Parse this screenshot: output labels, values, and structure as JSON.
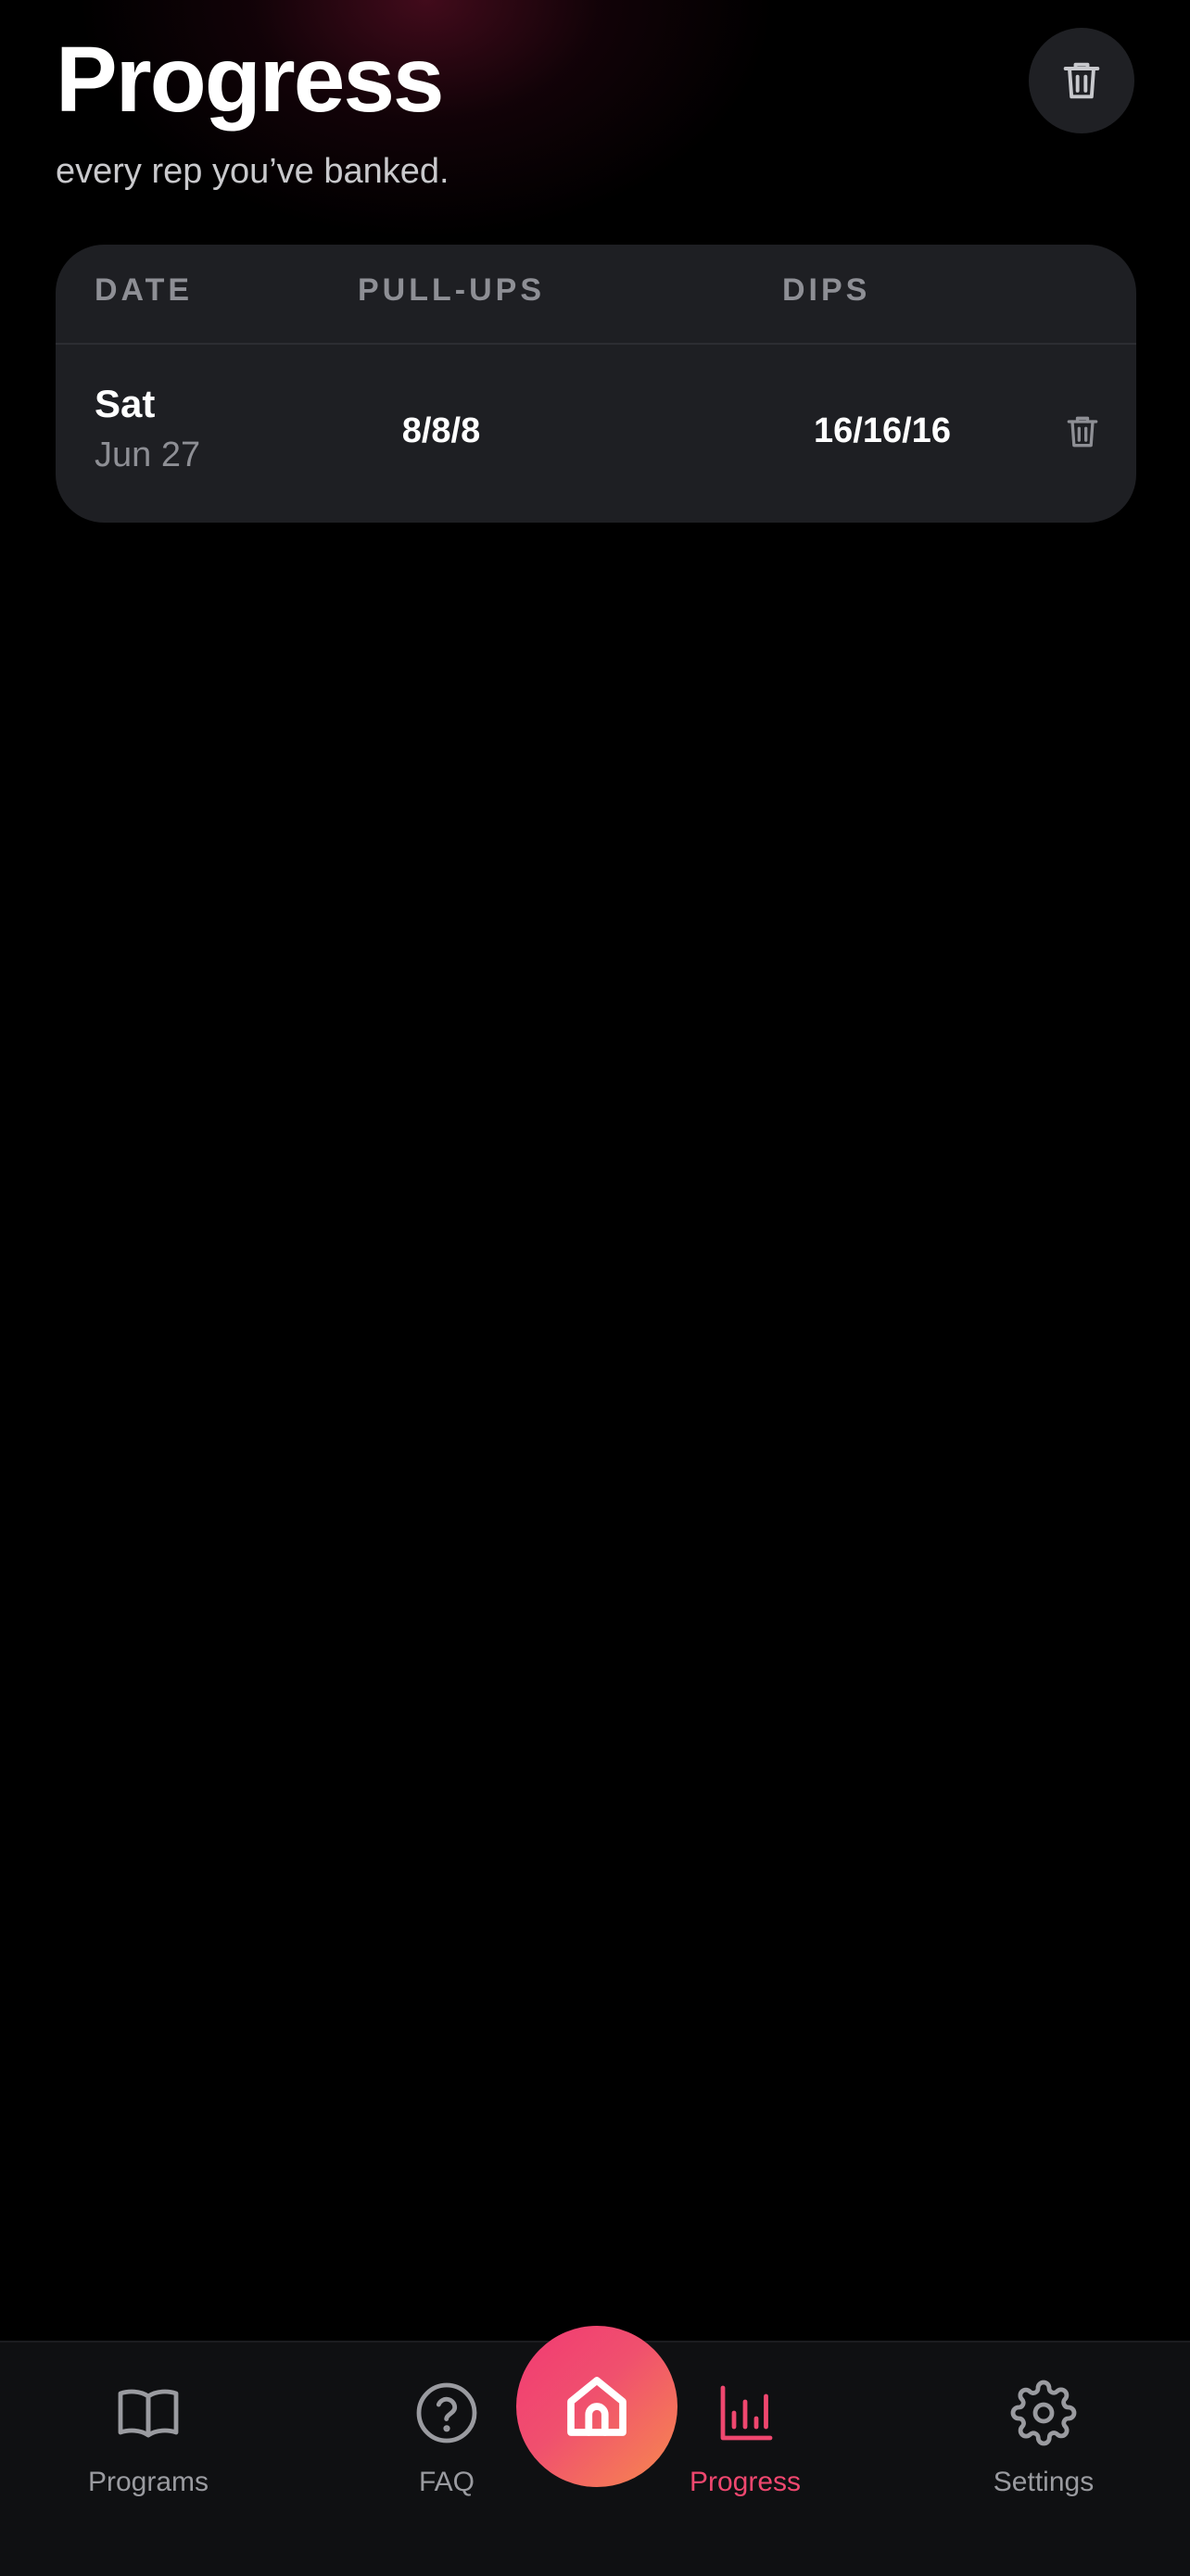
{
  "header": {
    "title": "Progress",
    "subtitle": "every rep you’ve banked."
  },
  "table": {
    "columns": [
      "DATE",
      "PULL-UPS",
      "DIPS"
    ],
    "rows": [
      {
        "day": "Sat",
        "date": "Jun 27",
        "pullups": "8/8/8",
        "dips": "16/16/16"
      }
    ]
  },
  "nav": {
    "items": [
      {
        "label": "Programs",
        "icon": "book-icon"
      },
      {
        "label": "FAQ",
        "icon": "help-circle-icon"
      },
      {
        "label": "",
        "icon": "home-icon"
      },
      {
        "label": "Progress",
        "icon": "bar-chart-icon"
      },
      {
        "label": "Settings",
        "icon": "gear-icon"
      }
    ],
    "active": "Progress"
  },
  "colors": {
    "accent": "#ef476f",
    "home_gradient_start": "#f23a73",
    "home_gradient_end": "#f78a4e",
    "card_bg": "#1e1f23",
    "background": "#000000"
  }
}
